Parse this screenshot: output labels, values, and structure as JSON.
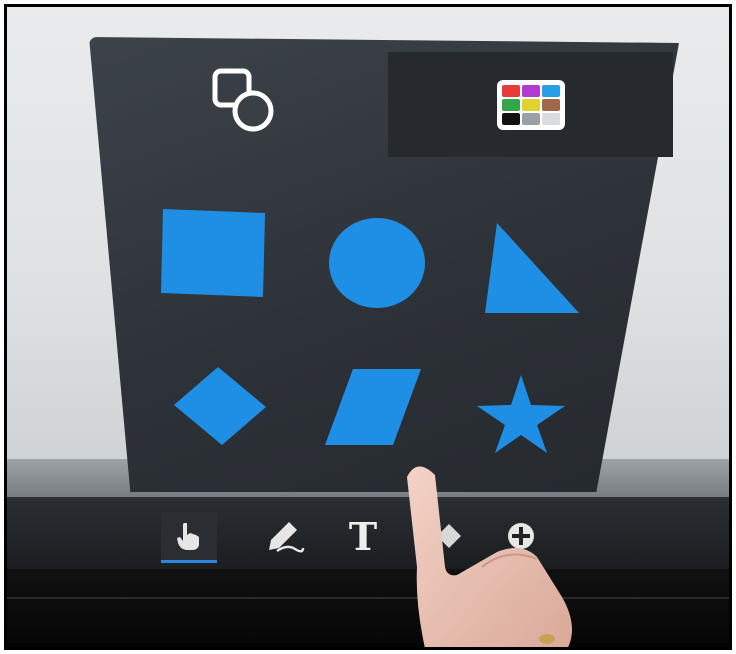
{
  "panel": {
    "tabs": [
      {
        "icon": "shapes-icon",
        "active": true
      },
      {
        "icon": "color-palette-icon",
        "active": false
      }
    ],
    "palette_colors": [
      "#e63b3b",
      "#b03bd1",
      "#2a9de8",
      "#33a64a",
      "#e0d22a",
      "#a0684a",
      "#111111",
      "#9aa0a6",
      "#d8dcdf"
    ],
    "shape_color": "#1f8fe6",
    "shapes": [
      {
        "name": "square"
      },
      {
        "name": "circle"
      },
      {
        "name": "triangle"
      },
      {
        "name": "diamond"
      },
      {
        "name": "parallelogram"
      },
      {
        "name": "star"
      }
    ]
  },
  "toolbar": {
    "tools": [
      {
        "icon": "hand-pointer-icon",
        "active": true
      },
      {
        "icon": "pen-icon",
        "active": false
      },
      {
        "icon": "text-icon",
        "glyph": "T",
        "active": false
      },
      {
        "icon": "shape-tool-icon",
        "active": false
      },
      {
        "icon": "plus-icon",
        "active": false
      }
    ],
    "accent": "#2f86e0"
  }
}
